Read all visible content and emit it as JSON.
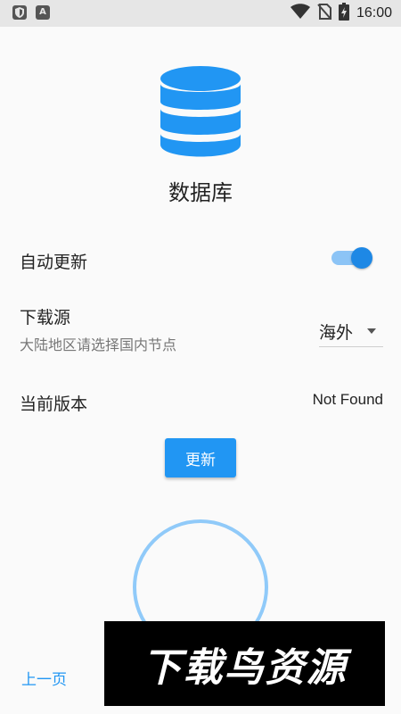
{
  "status_bar": {
    "left_icons": [
      "shield-icon",
      "a-icon"
    ],
    "right_icons": [
      "wifi-icon",
      "no-sim-icon",
      "battery-charging-icon"
    ],
    "time": "16:00"
  },
  "header": {
    "icon": "database-icon",
    "title": "数据库"
  },
  "settings": {
    "auto_update": {
      "label": "自动更新",
      "enabled": true
    },
    "source": {
      "label": "下载源",
      "hint": "大陆地区请选择国内节点",
      "selected": "海外"
    },
    "version": {
      "label": "当前版本",
      "value": "Not Found"
    }
  },
  "actions": {
    "update_label": "更新"
  },
  "progress": {
    "ring_fraction": 1.0
  },
  "footer": {
    "prev_label": "上一页"
  },
  "watermark": {
    "text": "下载鸟资源"
  },
  "colors": {
    "accent": "#2196f3",
    "accent_light": "#8cc4f6",
    "background": "#fafafa",
    "status_bar": "#e6e6e6"
  }
}
